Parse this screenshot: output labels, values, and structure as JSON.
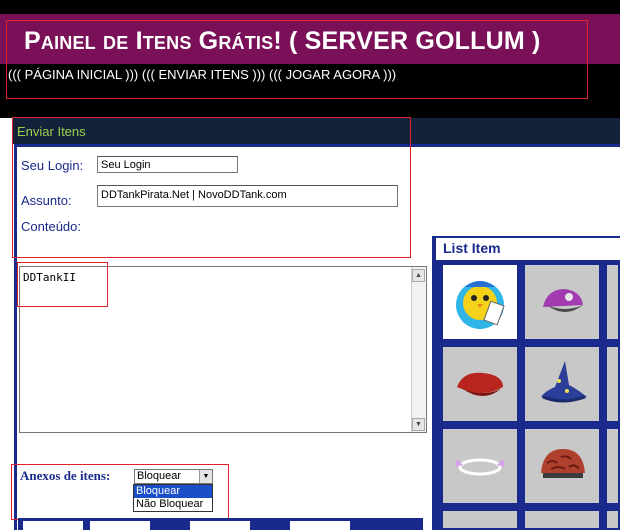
{
  "header": {
    "title": "Painel de Itens Grátis! ( SERVER GOLLUM )",
    "nav": [
      "((( PÁGINA INICIAL )))",
      "((( ENVIAR ITENS )))",
      "((( JOGAR AGORA )))"
    ]
  },
  "form": {
    "panel_title": "Enviar Itens",
    "login_label": "Seu Login:",
    "login_value": "Seu Login",
    "assunto_label": "Assunto:",
    "assunto_value": "DDTankPirata.Net | NovoDDTank.com",
    "conteudo_label": "Conteúdo:",
    "conteudo_value": "DDTankII",
    "anexos_label": "Anexos de itens:",
    "anexos_selected": "Bloquear",
    "anexos_options": [
      "Bloquear",
      "Não Bloquear"
    ]
  },
  "list": {
    "title": "List Item",
    "items": [
      {
        "icon": "chick-reading-book-icon",
        "selected": true
      },
      {
        "icon": "purple-cap-icon",
        "selected": false
      },
      {
        "icon": "red-beret-icon",
        "selected": false
      },
      {
        "icon": "wizard-hat-icon",
        "selected": false
      },
      {
        "icon": "white-halo-icon",
        "selected": false
      },
      {
        "icon": "brain-helmet-icon",
        "selected": false
      }
    ]
  },
  "colors": {
    "header_band": "#7a1058",
    "accent_blue": "#1a2a8c",
    "panel_head": "#14213a",
    "panel_head_text": "#9ad04a",
    "highlight_box": "#e0212a",
    "selected_option": "#1a4fc8"
  }
}
